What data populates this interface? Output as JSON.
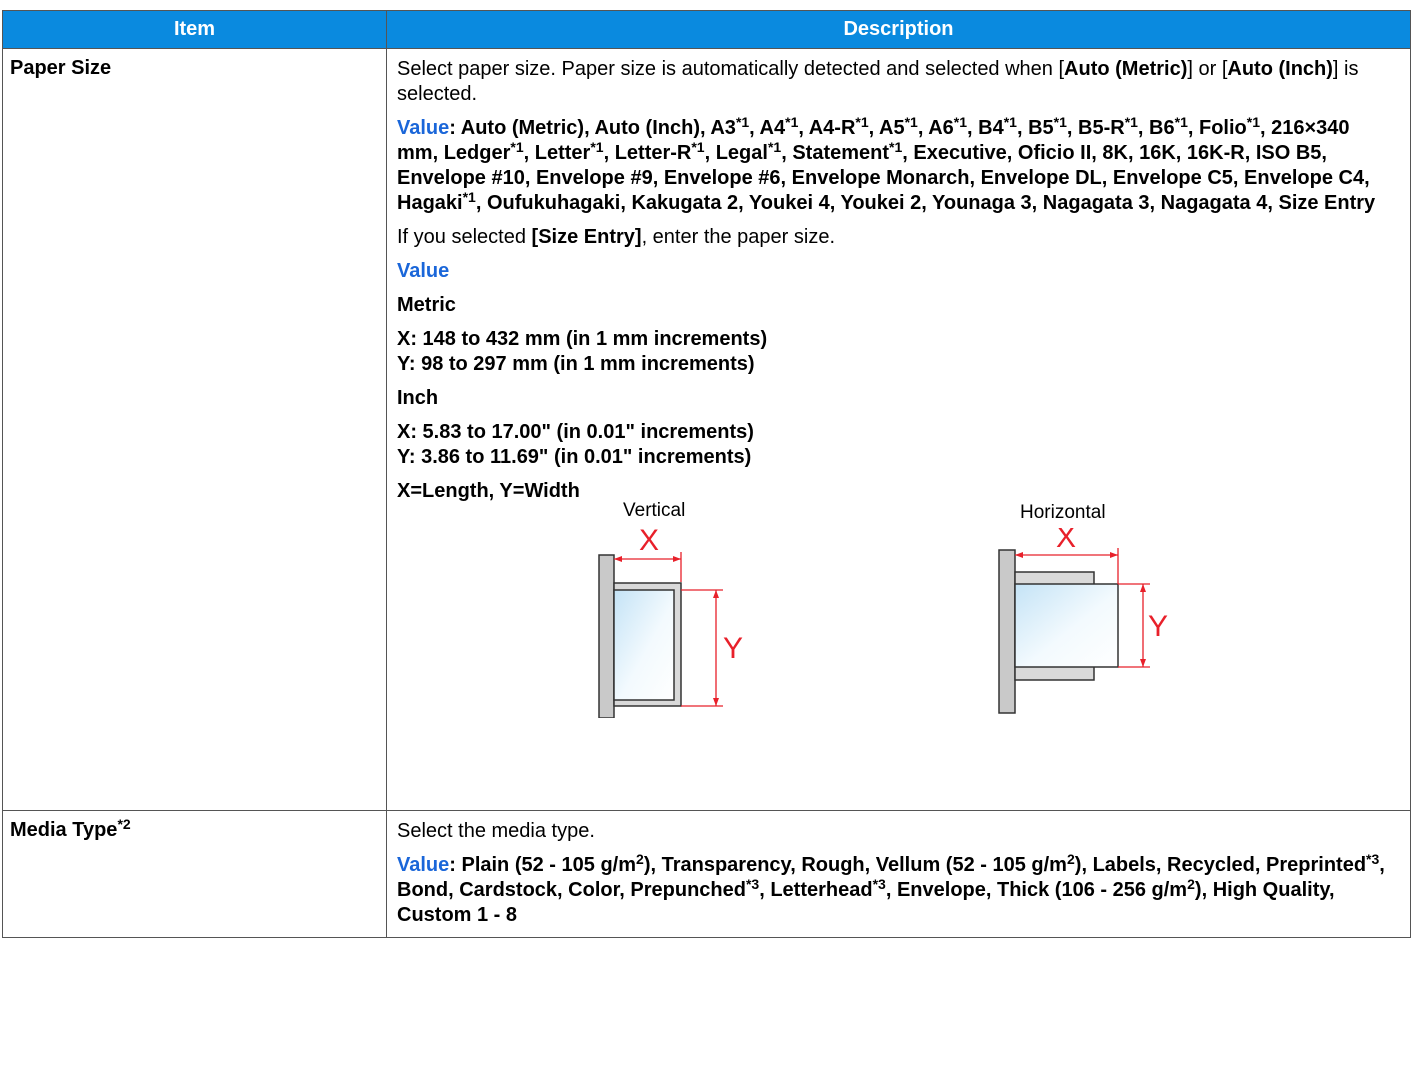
{
  "table": {
    "headers": {
      "item": "Item",
      "description": "Description"
    },
    "rows": {
      "paper_size": {
        "item": "Paper Size",
        "intro": {
          "prefix": "Select paper size. Paper size is automatically detected and selected when [",
          "opt1": "Auto (Metric)",
          "mid": "] or [",
          "opt2": "Auto (Inch)",
          "suffix": "] is selected."
        },
        "value_label": "Value",
        "value_colon": ": ",
        "values_text": "Auto (Metric), Auto (Inch), A3, A4, A4-R, A5, A6, B4, B5, B5-R, B6, Folio, 216×340 mm, Ledger, Letter, Letter-R, Legal, Statement, Executive, Oficio II, 8K, 16K, 16K-R, ISO B5, Envelope #10, Envelope #9, Envelope #6, Envelope Monarch, Envelope DL, Envelope C5, Envelope C4, Hagaki, Oufukuhagaki, Kakugata 2, Youkei 4, Youkei 2, Younaga 3, Nagagata 3, Nagagata 4, Size Entry",
        "footnote_mark": "*1",
        "size_entry_text": {
          "prefix": "If you selected ",
          "bold": "[Size Entry]",
          "suffix": ", enter the paper size."
        },
        "value_heading": "Value",
        "metric": {
          "label": "Metric",
          "x": "X: 148 to 432 mm (in 1 mm increments)",
          "y": "Y: 98 to 297 mm (in 1 mm increments)"
        },
        "inch": {
          "label": "Inch",
          "x": "X: 5.83 to 17.00\" (in 0.01\" increments)",
          "y": "Y: 3.86 to 11.69\" (in 0.01\" increments)"
        },
        "xy_note": "X=Length, Y=Width",
        "diagram": {
          "vertical_label": "Vertical",
          "horizontal_label": "Horizontal",
          "x_letter": "X",
          "y_letter": "Y",
          "dimension_color": "#e8202a"
        }
      },
      "media_type": {
        "item": "Media Type",
        "item_mark": "*2",
        "intro": "Select the media type.",
        "value_label": "Value",
        "value_colon": ": ",
        "values_text": "Plain (52 - 105 g/m2), Transparency, Rough, Vellum (52 - 105 g/m2), Labels, Recycled, Preprinted*3, Bond, Cardstock, Color, Prepunched*3, Letterhead*3, Envelope, Thick (106 - 256 g/m2), High Quality, Custom 1 - 8"
      }
    }
  },
  "colors": {
    "header_bg": "#0a8adf",
    "header_text": "#ffffff",
    "value_blue": "#1a66d9",
    "border": "#555555"
  }
}
